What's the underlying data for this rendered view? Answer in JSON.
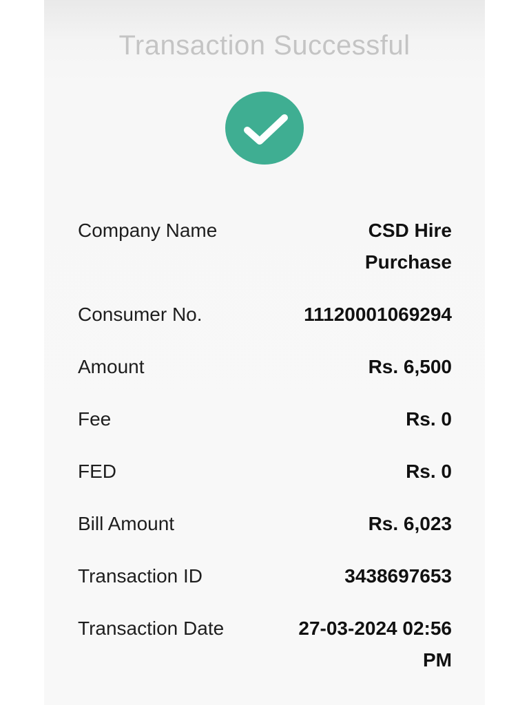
{
  "header": {
    "title": "Transaction Successful"
  },
  "status_icon": {
    "icon": "checkmark-icon",
    "color": "#3fae92"
  },
  "details": [
    {
      "label": "Company Name",
      "value": "CSD Hire Purchase"
    },
    {
      "label": "Consumer No.",
      "value": "11120001069294"
    },
    {
      "label": "Amount",
      "value": "Rs. 6,500"
    },
    {
      "label": "Fee",
      "value": "Rs. 0"
    },
    {
      "label": "FED",
      "value": "Rs. 0"
    },
    {
      "label": "Bill Amount",
      "value": "Rs. 6,023"
    },
    {
      "label": "Transaction ID",
      "value": "3438697653"
    },
    {
      "label": "Transaction Date",
      "value": "27-03-2024 02:56 PM"
    }
  ]
}
